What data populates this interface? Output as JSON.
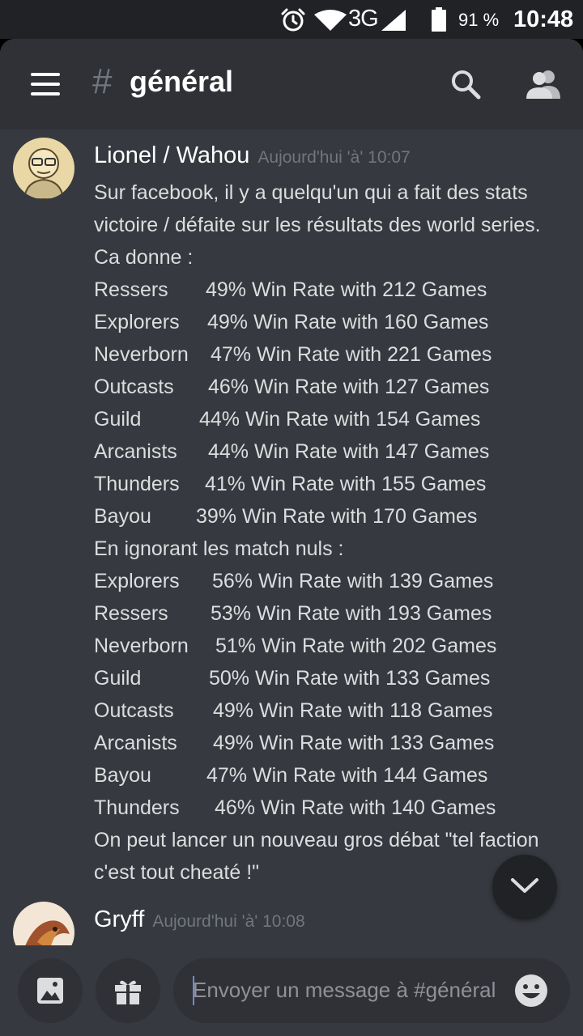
{
  "status_bar": {
    "network": "3G",
    "battery": "91 %",
    "time": "10:48",
    "icons": [
      "alarm-icon",
      "wifi-icon",
      "signal-icon",
      "battery-icon"
    ]
  },
  "header": {
    "hash": "#",
    "channel": "général",
    "icons": [
      "menu-icon",
      "search-icon",
      "members-icon"
    ]
  },
  "messages": [
    {
      "author": "Lionel / Wahou",
      "timestamp": "Aujourd'hui 'à' 10:07",
      "intro": [
        "Sur facebook, il y a quelqu'un qui a fait des stats",
        "victoire / défaite sur les résultats des world series.",
        "Ca donne :"
      ],
      "stats1": [
        {
          "faction": "Ressers",
          "stat": "49% Win Rate with 212 Games"
        },
        {
          "faction": "Explorers",
          "stat": "49% Win Rate with 160 Games"
        },
        {
          "faction": "Neverborn",
          "stat": "47% Win Rate with 221 Games"
        },
        {
          "faction": "Outcasts",
          "stat": "46% Win Rate with 127 Games"
        },
        {
          "faction": "Guild",
          "stat": "44% Win Rate with 154 Games"
        },
        {
          "faction": "Arcanists",
          "stat": "44% Win Rate with 147 Games"
        },
        {
          "faction": "Thunders",
          "stat": "41% Win Rate with 155 Games"
        },
        {
          "faction": "Bayou",
          "stat": "39% Win Rate with 170 Games"
        }
      ],
      "middle": "En ignorant les match nuls :",
      "stats2": [
        {
          "faction": "Explorers",
          "stat": "56% Win Rate with 139 Games"
        },
        {
          "faction": "Ressers",
          "stat": "53% Win Rate with 193 Games"
        },
        {
          "faction": "Neverborn",
          "stat": "51% Win Rate with 202 Games"
        },
        {
          "faction": "Guild",
          "stat": "50% Win Rate with 133 Games"
        },
        {
          "faction": "Outcasts",
          "stat": "49% Win Rate with 118 Games"
        },
        {
          "faction": "Arcanists",
          "stat": "49% Win Rate with 133 Games"
        },
        {
          "faction": "Bayou",
          "stat": "47% Win Rate with 144 Games"
        },
        {
          "faction": "Thunders",
          "stat": "46% Win Rate with 140 Games"
        }
      ],
      "outro": [
        "On peut lancer un nouveau gros débat \"tel faction",
        "c'est tout cheaté !\""
      ]
    },
    {
      "author": "Gryff",
      "timestamp": "Aujourd'hui 'à' 10:08"
    }
  ],
  "composer": {
    "placeholder": "Envoyer un message à #général",
    "icons": [
      "image-icon",
      "gift-icon",
      "emoji-icon"
    ]
  },
  "colors": {
    "background": "#36393f",
    "header": "#2f3136",
    "accent": "#7289da"
  }
}
